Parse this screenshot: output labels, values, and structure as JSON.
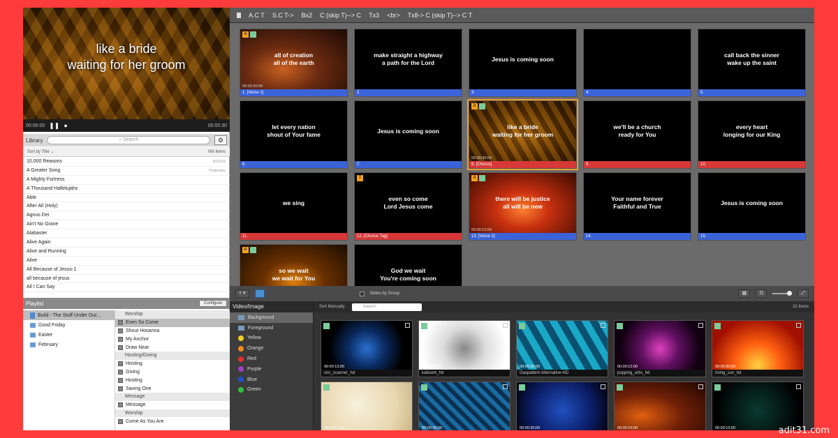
{
  "preview": {
    "lyric_lines": [
      "like a bride",
      "waiting for her groom"
    ],
    "time_elapsed": "00:00:00",
    "time_total": "00:00:30"
  },
  "library": {
    "title": "Library",
    "search_placeholder": "Search",
    "sort_label": "Sort by Title",
    "count_label": "NN Items",
    "songs": [
      {
        "name": "10,000 Reasons",
        "date": "8/15/15"
      },
      {
        "name": "A Greater Song",
        "date": "Yesterday"
      },
      {
        "name": "A Mighty Fortress",
        "date": ""
      },
      {
        "name": "A Thousand Hallelujahs",
        "date": ""
      },
      {
        "name": "Able",
        "date": ""
      },
      {
        "name": "After All (Holy)",
        "date": ""
      },
      {
        "name": "Agnus Dei",
        "date": ""
      },
      {
        "name": "Ain't No Grave",
        "date": ""
      },
      {
        "name": "Alabaster",
        "date": ""
      },
      {
        "name": "Alive Again",
        "date": ""
      },
      {
        "name": "Alive and Running",
        "date": ""
      },
      {
        "name": "Alive",
        "date": ""
      },
      {
        "name": "All Because of Jesus-1",
        "date": ""
      },
      {
        "name": "all because of jesus",
        "date": ""
      },
      {
        "name": "All I Can Say",
        "date": ""
      }
    ]
  },
  "playlist": {
    "title": "Playlist",
    "configure_label": "Configure",
    "groups": [
      {
        "name": "Build - The Stuff Under Our...",
        "type": "doc",
        "selected": true
      },
      {
        "name": "Good Friday",
        "type": "folder",
        "selected": false
      },
      {
        "name": "Easter",
        "type": "folder",
        "selected": false
      },
      {
        "name": "February",
        "type": "folder",
        "selected": false
      }
    ],
    "items": [
      {
        "name": "Worship",
        "header": true,
        "selected": false
      },
      {
        "name": "Even So Come",
        "header": false,
        "selected": true
      },
      {
        "name": "Shout Hosanna",
        "header": false,
        "selected": false
      },
      {
        "name": "My Anchor",
        "header": false,
        "selected": false
      },
      {
        "name": "Draw Near",
        "header": false,
        "selected": false
      },
      {
        "name": "Hosting/Giving",
        "header": true,
        "selected": false
      },
      {
        "name": "Hosting",
        "header": false,
        "selected": false
      },
      {
        "name": "Giving",
        "header": false,
        "selected": false
      },
      {
        "name": "Hosting",
        "header": false,
        "selected": false
      },
      {
        "name": "Saving One",
        "header": false,
        "selected": false
      },
      {
        "name": "Message",
        "header": true,
        "selected": false
      },
      {
        "name": "Message",
        "header": false,
        "selected": false
      },
      {
        "name": "Worship",
        "header": true,
        "selected": false
      },
      {
        "name": "Come As You Are",
        "header": false,
        "selected": false
      }
    ]
  },
  "arrangement": [
    "A.C T",
    "S.C T->",
    "Bx2",
    "C (skip T)--> C",
    "Tx3",
    "<br>",
    "Tx8-> C (skip T)--> C T"
  ],
  "slides": [
    {
      "lines": [
        "all of creation",
        "all of the earth"
      ],
      "label": "1. [Verse 1]",
      "color": "blue",
      "bg": "sky",
      "time": "00:00:20:00",
      "badges": [
        "A",
        "img"
      ],
      "selected": false
    },
    {
      "lines": [
        "make straight a highway",
        "a path for the Lord"
      ],
      "label": "2.",
      "color": "blue",
      "bg": "",
      "time": "",
      "badges": [],
      "selected": false
    },
    {
      "lines": [
        "Jesus is coming soon"
      ],
      "label": "3.",
      "color": "blue",
      "bg": "",
      "time": "",
      "badges": [],
      "selected": false
    },
    {
      "lines": [],
      "label": "4.",
      "color": "blue",
      "bg": "",
      "time": "",
      "badges": [],
      "selected": false
    },
    {
      "lines": [
        "call back the sinner",
        "wake up the saint"
      ],
      "label": "5.",
      "color": "blue",
      "bg": "",
      "time": "",
      "badges": [],
      "selected": false
    },
    {
      "lines": [
        "let every nation",
        "shout of Your fame"
      ],
      "label": "6.",
      "color": "blue",
      "bg": "",
      "time": "",
      "badges": [],
      "selected": false
    },
    {
      "lines": [
        "Jesus is coming soon"
      ],
      "label": "7.",
      "color": "blue",
      "bg": "",
      "time": "",
      "badges": [],
      "selected": false
    },
    {
      "lines": [
        "like a bride",
        "waiting for her groom"
      ],
      "label": "8. [Chorus]",
      "color": "red",
      "bg": "gold",
      "time": "00:00:30:00",
      "badges": [
        "A",
        "img"
      ],
      "selected": true
    },
    {
      "lines": [
        "we'll be a church",
        "ready for You"
      ],
      "label": "9.",
      "color": "red",
      "bg": "",
      "time": "",
      "badges": [],
      "selected": false
    },
    {
      "lines": [
        "every heart",
        "longing for our King"
      ],
      "label": "10.",
      "color": "red",
      "bg": "",
      "time": "",
      "badges": [],
      "selected": false
    },
    {
      "lines": [
        "we sing"
      ],
      "label": "11.",
      "color": "red",
      "bg": "",
      "time": "",
      "badges": [],
      "selected": false
    },
    {
      "lines": [
        "even so come",
        "Lord Jesus come"
      ],
      "label": "12. [Chorus Tag]",
      "color": "red",
      "bg": "",
      "time": "",
      "badges": [
        "T"
      ],
      "selected": false
    },
    {
      "lines": [
        "there will be justice",
        "all will be new"
      ],
      "label": "13. [Verse 2]",
      "color": "blue",
      "bg": "fire",
      "time": "00:00:12:00",
      "badges": [
        "A",
        "img"
      ],
      "selected": false
    },
    {
      "lines": [
        "Your name forever",
        "Faithful and True"
      ],
      "label": "14.",
      "color": "blue",
      "bg": "",
      "time": "",
      "badges": [],
      "selected": false
    },
    {
      "lines": [
        "Jesus is coming soon"
      ],
      "label": "15.",
      "color": "blue",
      "bg": "",
      "time": "",
      "badges": [],
      "selected": false
    },
    {
      "lines": [
        "so we wait",
        "we wait for You"
      ],
      "label": "",
      "color": "",
      "bg": "bokeh",
      "time": "",
      "badges": [
        "A",
        "img"
      ],
      "selected": false
    },
    {
      "lines": [
        "God we wait",
        "You're coming soon"
      ],
      "label": "",
      "color": "",
      "bg": "",
      "time": "",
      "badges": [],
      "selected": false
    }
  ],
  "midbar": {
    "add_label": "+ ▾",
    "slides_by_group": "Slides by Group"
  },
  "media": {
    "title": "Video/Image",
    "sort_label": "Sort Manually",
    "search_placeholder": "Search",
    "count": "32 Items",
    "categories": [
      {
        "name": "Background",
        "color": "#7a9abc",
        "kind": "square",
        "selected": true
      },
      {
        "name": "Foreground",
        "color": "#7a9abc",
        "kind": "square",
        "selected": false
      },
      {
        "name": "Yellow",
        "color": "#f0d020",
        "kind": "dot",
        "selected": false
      },
      {
        "name": "Orange",
        "color": "#f08a20",
        "kind": "dot",
        "selected": false
      },
      {
        "name": "Red",
        "color": "#e03030",
        "kind": "dot",
        "selected": false
      },
      {
        "name": "Purple",
        "color": "#a040c0",
        "kind": "dot",
        "selected": false
      },
      {
        "name": "Blue",
        "color": "#2050d0",
        "kind": "dot",
        "selected": false
      },
      {
        "name": "Green",
        "color": "#30c040",
        "kind": "dot",
        "selected": false
      }
    ],
    "thumbs": [
      {
        "name": "circ_scanner_hd",
        "time": "00:00:12;00",
        "bg": "radial-gradient(circle at 50% 50%, #2a70d0 0%, #0a2a60 35%, #000 70%)"
      },
      {
        "name": "kaboom_hd",
        "time": "00:00:30;00",
        "bg": "radial-gradient(circle at 50% 50%, #888 0%, #ddd 40%, #fff 80%)"
      },
      {
        "name": "Gaspattern Alternative-HD",
        "time": "00:00:30;00",
        "bg": "repeating-linear-gradient(60deg, #1aa8c8 0 10px, #0a5070 10px 20px)"
      },
      {
        "name": "popping_orbs_hd",
        "time": "00:00:12;00",
        "bg": "radial-gradient(circle at 50% 50%, #e040c0 0%, #601060 35%, #100010 75%)"
      },
      {
        "name": "rising_sun_hd",
        "time": "00:00:30;00",
        "bg": "radial-gradient(ellipse at 50% 80%, #ffd040 0%, #ff6010 35%, #a01000 75%)"
      },
      {
        "name": "",
        "time": "00:00:17;25",
        "bg": "radial-gradient(circle at 40% 40%, #f8f0dc 0%, #e8d8b0 60%, #c8b080 100%)"
      },
      {
        "name": "",
        "time": "00:00:30;00",
        "bg": "repeating-linear-gradient(45deg, #1a6aa0 0 6px, #0a3050 6px 12px)"
      },
      {
        "name": "",
        "time": "00:00:30;00",
        "bg": "radial-gradient(circle at 50% 50%, #2050c0 0%, #0a1a60 60%, #000 100%)"
      },
      {
        "name": "",
        "time": "00:00:10;00",
        "bg": "radial-gradient(ellipse at 30% 60%, #e06010 0%, #702008 45%, #200500 100%)"
      },
      {
        "name": "",
        "time": "00:00:12;00",
        "bg": "radial-gradient(circle at 50% 50%, #0a3a30 0%, #000 80%)"
      }
    ]
  },
  "watermark": "adit31.com"
}
